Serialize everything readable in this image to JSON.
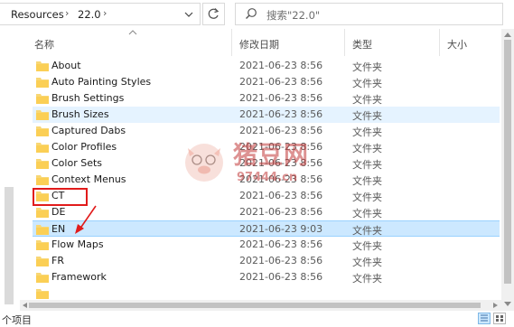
{
  "address_bar": {
    "crumbs": [
      "Resources",
      "22.0"
    ],
    "search_placeholder": "搜索\"22.0\""
  },
  "columns": {
    "name": "名称",
    "date": "修改日期",
    "type": "类型",
    "size": "大小"
  },
  "files": [
    {
      "name": "About",
      "date": "2021-06-23 8:56",
      "type": "文件夹"
    },
    {
      "name": "Auto Painting Styles",
      "date": "2021-06-23 8:56",
      "type": "文件夹"
    },
    {
      "name": "Brush Settings",
      "date": "2021-06-23 8:56",
      "type": "文件夹"
    },
    {
      "name": "Brush Sizes",
      "date": "2021-06-23 8:56",
      "type": "文件夹"
    },
    {
      "name": "Captured Dabs",
      "date": "2021-06-23 8:56",
      "type": "文件夹"
    },
    {
      "name": "Color Profiles",
      "date": "2021-06-23 8:56",
      "type": "文件夹"
    },
    {
      "name": "Color Sets",
      "date": "2021-06-23 8:56",
      "type": "文件夹"
    },
    {
      "name": "Context Menus",
      "date": "2021-06-23 8:56",
      "type": "文件夹"
    },
    {
      "name": "CT",
      "date": "2021-06-23 8:56",
      "type": "文件夹"
    },
    {
      "name": "DE",
      "date": "2021-06-23 8:56",
      "type": "文件夹"
    },
    {
      "name": "EN",
      "date": "2021-06-23 9:03",
      "type": "文件夹"
    },
    {
      "name": "Flow Maps",
      "date": "2021-06-23 8:56",
      "type": "文件夹"
    },
    {
      "name": "FR",
      "date": "2021-06-23 8:56",
      "type": "文件夹"
    },
    {
      "name": "Framework",
      "date": "2021-06-23 8:56",
      "type": "文件夹"
    }
  ],
  "status": {
    "text": "个项目"
  },
  "watermark": {
    "brand": "猪豆网",
    "url": "97444.cn"
  },
  "colors": {
    "hover_row": "#e5f3ff",
    "selected_row": "#cce8ff",
    "folder": "#f8d775",
    "annotation": "#e11b1b"
  },
  "icons": [
    "chevron-right-icon",
    "chevron-down-icon",
    "refresh-icon",
    "search-icon",
    "folder-icon",
    "sort-up-icon",
    "details-view-icon",
    "large-icons-view-icon"
  ]
}
